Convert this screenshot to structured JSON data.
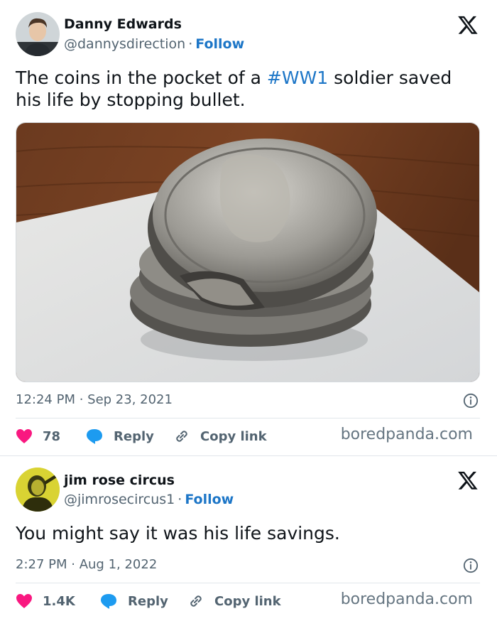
{
  "tweets": [
    {
      "name": "Danny Edwards",
      "handle": "@dannysdirection",
      "separator": "·",
      "follow": "Follow",
      "text_before": "The coins in the pocket of a ",
      "hashtag": "#WW1",
      "text_after": " soldier saved his life by stopping bullet.",
      "time": "12:24 PM",
      "date": "Sep 23, 2021",
      "likes": "78",
      "reply": "Reply",
      "copy_link": "Copy link",
      "brand": "boredpanda.com"
    },
    {
      "name": "jim rose circus",
      "handle": "@jimrosecircus1",
      "separator": "·",
      "follow": "Follow",
      "text": "You might say it was his life savings.",
      "time": "2:27 PM",
      "date": "Aug 1, 2022",
      "likes": "1.4K",
      "reply": "Reply",
      "copy_link": "Copy link",
      "brand": "boredpanda.com"
    }
  ],
  "colors": {
    "accent": "#1d76c7",
    "like": "#f91880",
    "reply": "#1d9bf0",
    "muted": "#536471"
  },
  "icons": [
    "x-logo-icon",
    "info-icon",
    "heart-icon",
    "reply-bubble-icon",
    "link-icon"
  ]
}
